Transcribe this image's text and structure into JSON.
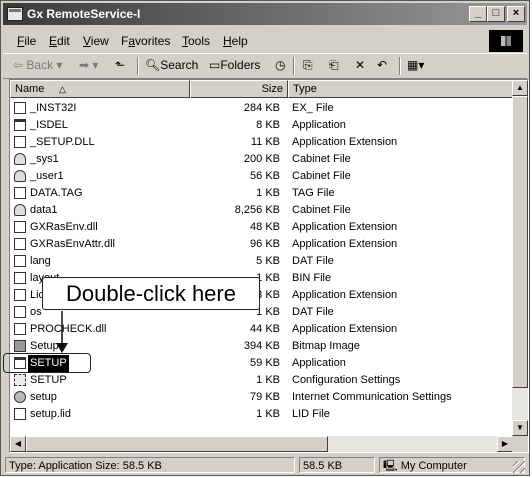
{
  "window": {
    "title": "Gx RemoteService-I"
  },
  "caption_buttons": {
    "minimize": "_",
    "maximize": "□",
    "close": "×"
  },
  "menu": [
    {
      "label": "File",
      "key": "F",
      "rest": "ile"
    },
    {
      "label": "Edit",
      "key": "E",
      "rest": "dit"
    },
    {
      "label": "View",
      "key": "V",
      "rest": "iew"
    },
    {
      "label": "Favorites",
      "key": "a",
      "prefix": "F",
      "rest": "vorites"
    },
    {
      "label": "Tools",
      "key": "T",
      "rest": "ools"
    },
    {
      "label": "Help",
      "key": "H",
      "rest": "elp"
    }
  ],
  "toolbar": {
    "back": "⇦ Back ▾",
    "forward": "➡ ▾",
    "up": "⬑",
    "search": "Search",
    "folders": "Folders",
    "history": "◷",
    "move_to": "⎘",
    "copy_to": "⎗",
    "delete": "✕",
    "undo": "↶",
    "views": "▦▾"
  },
  "columns": {
    "name": "Name",
    "sort_indicator": "△",
    "size": "Size",
    "type": "Type"
  },
  "files": [
    {
      "name": "_INST32I",
      "size": "284 KB",
      "type": "EX_ File",
      "icon": "file-icon"
    },
    {
      "name": "_ISDEL",
      "size": "8 KB",
      "type": "Application",
      "icon": "app-icon"
    },
    {
      "name": "_SETUP.DLL",
      "size": "11 KB",
      "type": "Application Extension",
      "icon": "dll-icon"
    },
    {
      "name": "_sys1",
      "size": "200 KB",
      "type": "Cabinet File",
      "icon": "cabinet-icon"
    },
    {
      "name": "_user1",
      "size": "56 KB",
      "type": "Cabinet File",
      "icon": "cabinet-icon"
    },
    {
      "name": "DATA.TAG",
      "size": "1 KB",
      "type": "TAG File",
      "icon": "file-icon"
    },
    {
      "name": "data1",
      "size": "8,256 KB",
      "type": "Cabinet File",
      "icon": "cabinet-icon"
    },
    {
      "name": "GXRasEnv.dll",
      "size": "48 KB",
      "type": "Application Extension",
      "icon": "dll-icon"
    },
    {
      "name": "GXRasEnvAttr.dll",
      "size": "96 KB",
      "type": "Application Extension",
      "icon": "dll-icon"
    },
    {
      "name": "lang",
      "size": "5 KB",
      "type": "DAT File",
      "icon": "file-icon"
    },
    {
      "name": "layout",
      "size": "1 KB",
      "type": "BIN File",
      "icon": "file-icon"
    },
    {
      "name": "Lic",
      "size": "3 KB",
      "type": "Application Extension",
      "icon": "dll-icon"
    },
    {
      "name": "os",
      "size": "1 KB",
      "type": "DAT File",
      "icon": "file-icon"
    },
    {
      "name": "PROCHECK.dll",
      "size": "44 KB",
      "type": "Application Extension",
      "icon": "dll-icon"
    },
    {
      "name": "Setup",
      "size": "394 KB",
      "type": "Bitmap Image",
      "icon": "bitmap-icon"
    },
    {
      "name": "SETUP",
      "size": "59 KB",
      "type": "Application",
      "icon": "setup-app-icon",
      "selected": true
    },
    {
      "name": "SETUP",
      "size": "1 KB",
      "type": "Configuration Settings",
      "icon": "config-icon"
    },
    {
      "name": "setup",
      "size": "79 KB",
      "type": "Internet Communication Settings",
      "icon": "settings-icon"
    },
    {
      "name": "setup.lid",
      "size": "1 KB",
      "type": "LID File",
      "icon": "file-icon"
    }
  ],
  "status": {
    "left": "Type: Application Size: 58.5 KB",
    "size": "58.5 KB",
    "zone": "My Computer"
  },
  "callout": {
    "text": "Double-click here"
  }
}
